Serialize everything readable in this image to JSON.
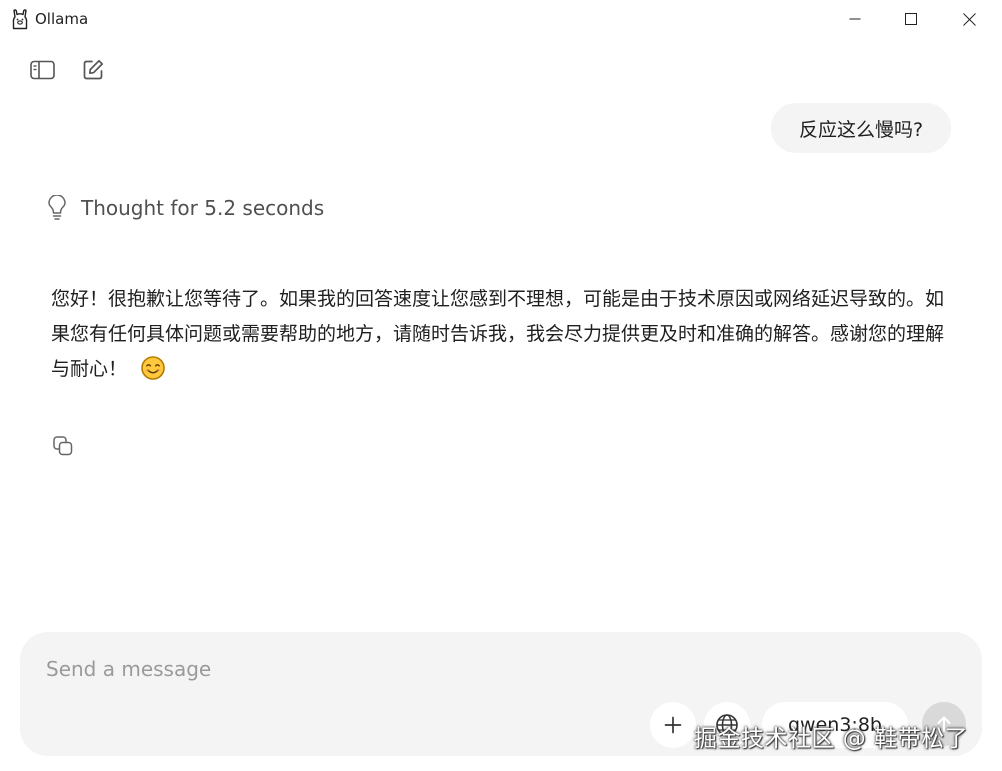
{
  "window": {
    "title": "Ollama",
    "app_icon": "ollama-llama-icon",
    "controls": [
      "minimize-icon",
      "maximize-icon",
      "close-icon"
    ]
  },
  "toolbar": {
    "icons": [
      "sidebar-toggle-icon",
      "new-chat-icon"
    ]
  },
  "conversation": {
    "user_message": "反应这么慢吗?",
    "thought": {
      "icon": "lightbulb-icon",
      "label": "Thought for 5.2 seconds"
    },
    "assistant_message": "您好！很抱歉让您等待了。如果我的回答速度让您感到不理想，可能是由于技术原因或网络延迟导致的。如果您有任何具体问题或需要帮助的地方，请随时告诉我，我会尽力提供更及时和准确的解答。感谢您的理解与耐心！",
    "assistant_emoji": "smiling-face-emoji",
    "copy_icon": "copy-icon"
  },
  "composer": {
    "placeholder": "Send a message",
    "value": "",
    "attach_icon": "plus-icon",
    "web_icon": "globe-icon",
    "model": "qwen3:8b",
    "send_icon": "arrow-up-icon"
  },
  "watermark": "掘金技术社区 @ 鞋带松了",
  "colors": {
    "background": "#ffffff",
    "bubble": "#f4f4f4",
    "composer": "#f4f4f4",
    "send_disabled": "#d9d9d9",
    "muted_text": "#9a9a9a"
  }
}
